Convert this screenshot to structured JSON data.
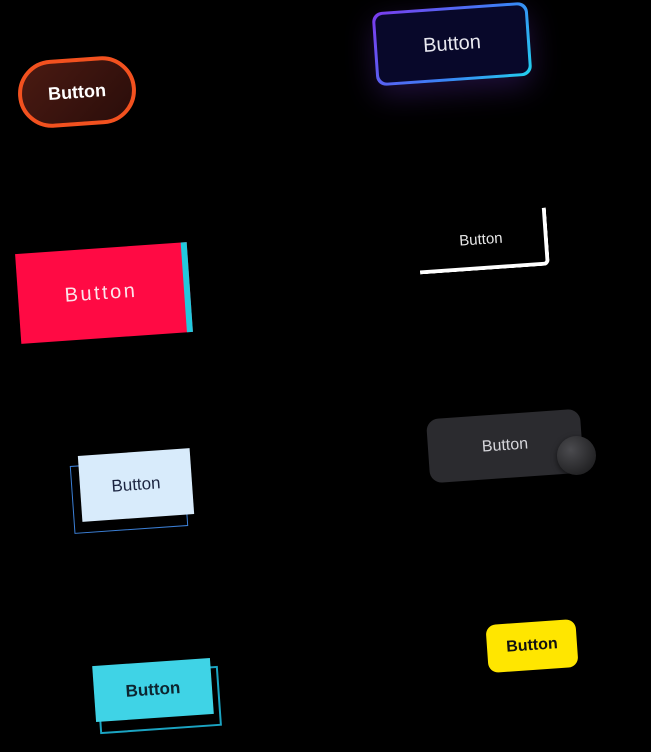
{
  "buttons": {
    "orange_pill": {
      "label": "Button"
    },
    "neon_gradient": {
      "label": "Button"
    },
    "red_cyan_edge": {
      "label": "Button"
    },
    "white_corner": {
      "label": "Button"
    },
    "dark_ball": {
      "label": "Button"
    },
    "light_blue_outline": {
      "label": "Button"
    },
    "yellow_pill": {
      "label": "Button"
    },
    "cyan_offset": {
      "label": "Button"
    }
  },
  "colors": {
    "background": "#000000",
    "orange_border": "#f2511f",
    "neon_purple": "#7c3aed",
    "neon_cyan": "#22d3ee",
    "red": "#ff0a44",
    "cyan_edge": "#22c9de",
    "dark_button": "#2b2b2f",
    "light_blue": "#d8ebfb",
    "outline_blue": "#3b7fd6",
    "yellow": "#ffe600",
    "cyan_button": "#3fd3e6"
  }
}
